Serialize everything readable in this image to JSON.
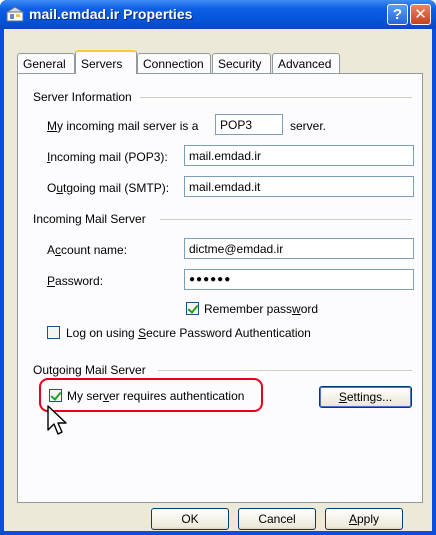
{
  "window": {
    "title": "mail.emdad.ir Properties",
    "help_symbol": "?",
    "close_symbol": "✕"
  },
  "tabs": [
    {
      "label": "General",
      "active": false
    },
    {
      "label": "Servers",
      "active": true
    },
    {
      "label": "Connection",
      "active": false
    },
    {
      "label": "Security",
      "active": false
    },
    {
      "label": "Advanced",
      "active": false
    }
  ],
  "server_info": {
    "group_label": "Server Information",
    "incoming_type_prefix": "My incoming mail server is a",
    "incoming_type_value": "POP3",
    "incoming_type_suffix": "server.",
    "incoming_label": "Incoming mail (POP3):",
    "incoming_value": "mail.emdad.ir",
    "outgoing_label": "Outgoing mail (SMTP):",
    "outgoing_value": "mail.emdad.it"
  },
  "incoming_server": {
    "group_label": "Incoming Mail Server",
    "account_label": "Account name:",
    "account_value": "dictme@emdad.ir",
    "password_label": "Password:",
    "password_value": "●●●●●●",
    "remember_label": "Remember password",
    "remember_checked": true,
    "spa_label": "Log on using Secure Password Authentication",
    "spa_checked": false
  },
  "outgoing_server": {
    "group_label": "Outgoing Mail Server",
    "auth_label": "My server requires authentication",
    "auth_checked": true,
    "settings_label": "Settings..."
  },
  "buttons": {
    "ok": "OK",
    "cancel": "Cancel",
    "apply": "Apply"
  }
}
